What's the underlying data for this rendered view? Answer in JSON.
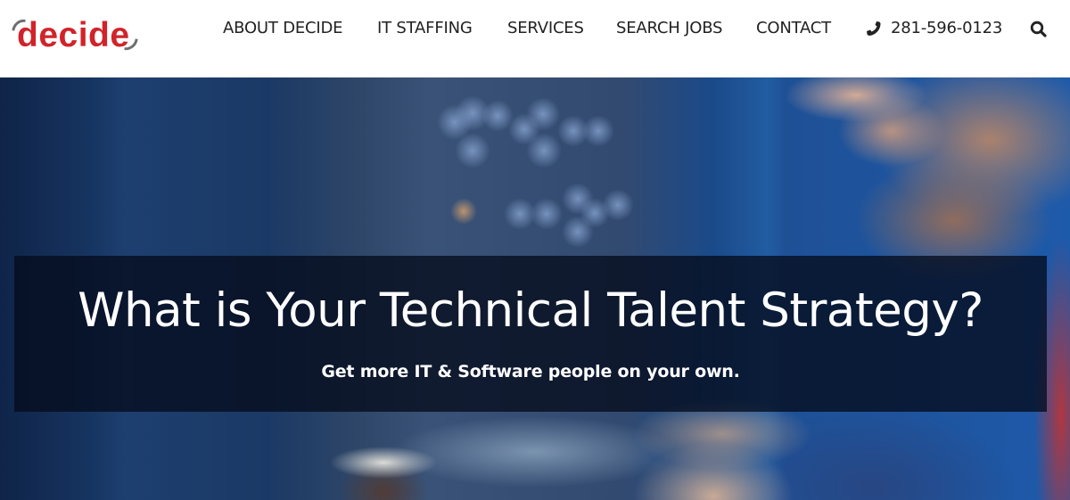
{
  "brand": {
    "name": "decide",
    "logo_color": "#d2232a",
    "arc_color": "#6d6e70"
  },
  "nav": {
    "items": [
      {
        "label": "ABOUT DECIDE"
      },
      {
        "label": "IT STAFFING"
      },
      {
        "label": "SERVICES"
      },
      {
        "label": "SEARCH JOBS"
      },
      {
        "label": "CONTACT"
      }
    ],
    "phone": {
      "icon": "phone-icon",
      "number": "281-596-0123"
    },
    "search": {
      "icon": "search-icon"
    }
  },
  "hero": {
    "title": "What is Your Technical Talent Strategy?",
    "subtitle": "Get more IT & Software people on your own.",
    "background_description": "blurred photo of a developer at a computer workstation"
  }
}
